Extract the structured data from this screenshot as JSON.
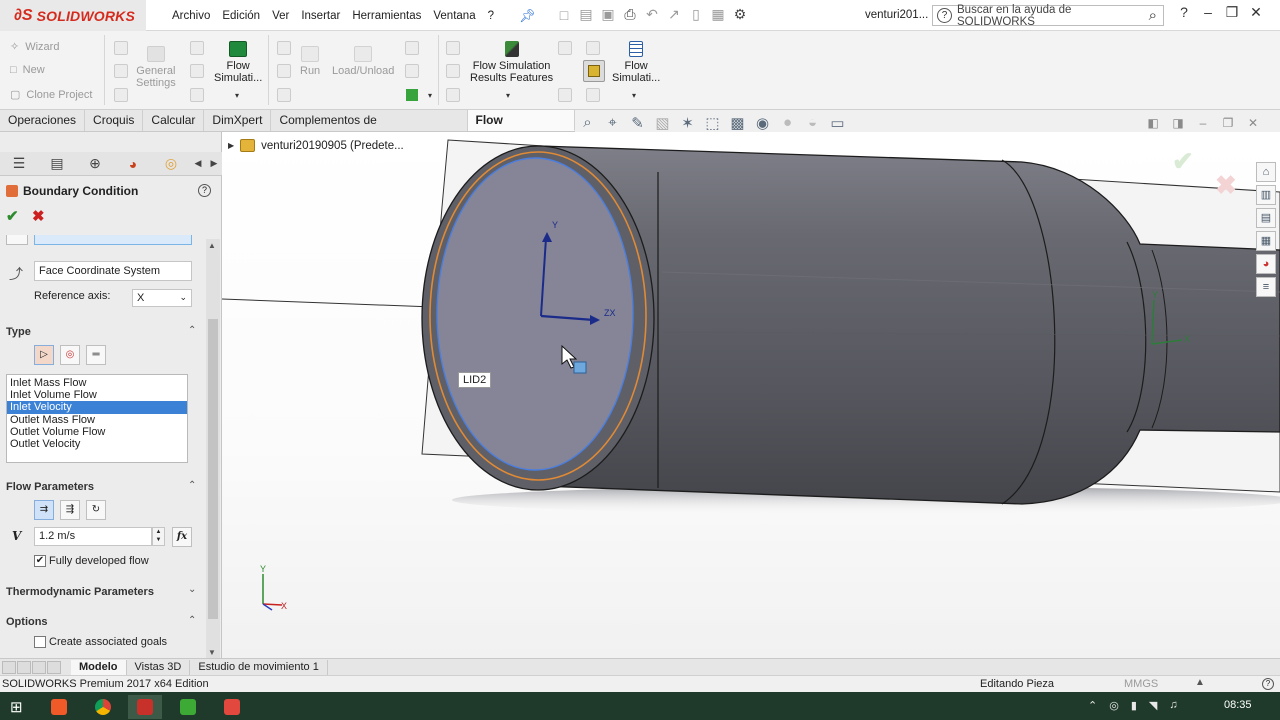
{
  "app": {
    "brand": "SOLIDWORKS",
    "document_title": "venturi201...",
    "help_search_placeholder": "Buscar en la ayuda de SOLIDWORKS"
  },
  "menu": [
    "Archivo",
    "Edición",
    "Ver",
    "Insertar",
    "Herramientas",
    "Ventana",
    "?"
  ],
  "ribbon": {
    "wizard": "Wizard",
    "new": "New",
    "clone_project": "Clone Project",
    "general_settings_1": "General",
    "general_settings_2": "Settings",
    "flow_sim_1": "Flow",
    "flow_sim_2": "Simulati...",
    "run": "Run",
    "load_unload": "Load/Unload",
    "results_features_1": "Flow Simulation",
    "results_features_2": "Results Features",
    "flow_sim_b_1": "Flow",
    "flow_sim_b_2": "Simulati..."
  },
  "tabs": [
    "Operaciones",
    "Croquis",
    "Calcular",
    "DimXpert",
    "Complementos de SOLIDWORKS",
    "Flow Simulation"
  ],
  "active_tab": "Flow Simulation",
  "viewport": {
    "tree_node": "venturi20190905  (Predete...",
    "face_tag": "LID2"
  },
  "property_manager": {
    "title": "Boundary Condition",
    "coordinate_system": "Face Coordinate System",
    "reference_axis_label": "Reference axis:",
    "reference_axis_value": "X",
    "type_section": "Type",
    "type_options": [
      "Inlet Mass Flow",
      "Inlet Volume Flow",
      "Inlet Velocity",
      "Outlet Mass Flow",
      "Outlet Volume Flow",
      "Outlet Velocity"
    ],
    "selected_type": "Inlet Velocity",
    "flow_params_section": "Flow Parameters",
    "velocity_symbol": "V",
    "velocity_value": "1.2 m/s",
    "fx_label": "fx",
    "fully_developed_label": "Fully developed flow",
    "fully_developed_checked": true,
    "thermo_section": "Thermodynamic Parameters",
    "options_section": "Options",
    "create_goals_label": "Create associated goals",
    "create_goals_checked": false
  },
  "bottom_tabs": [
    "Modelo",
    "Vistas 3D",
    "Estudio de movimiento 1"
  ],
  "active_bottom_tab": "Modelo",
  "status": {
    "edition": "SOLIDWORKS Premium 2017 x64 Edition",
    "mode": "Editando Pieza",
    "units": "MMGS"
  },
  "taskbar": {
    "clock": "08:35"
  },
  "colors": {
    "brand_red": "#d52b1e",
    "selection_blue": "#3b82d6",
    "part_gray": "#64656d",
    "taskbar": "#1f3a2a"
  }
}
